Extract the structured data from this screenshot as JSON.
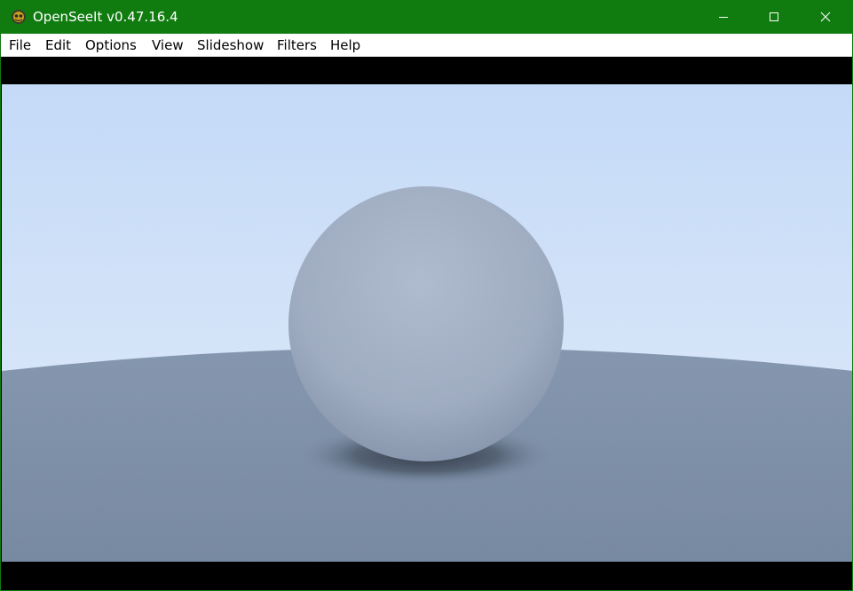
{
  "window": {
    "title": "OpenSeeIt v0.47.16.4",
    "app_icon": "openseeit-app-icon",
    "controls": {
      "minimize_icon": "minimize-icon",
      "maximize_icon": "maximize-icon",
      "close_icon": "close-icon"
    },
    "accent": "#107c10"
  },
  "menu": {
    "items": [
      {
        "label": "File"
      },
      {
        "label": "Edit"
      },
      {
        "label": "Options"
      },
      {
        "label": "View"
      },
      {
        "label": "Slideshow"
      },
      {
        "label": "Filters"
      },
      {
        "label": "Help"
      }
    ]
  },
  "image": {
    "content": "rendered-sphere-scene",
    "letterbox_color": "#000000",
    "sky_top_color": "#c4dcfb",
    "sky_horizon_color": "#e6f0ff",
    "ground_color": "#7b8ca4",
    "sphere_color": "#a2b0c6"
  }
}
